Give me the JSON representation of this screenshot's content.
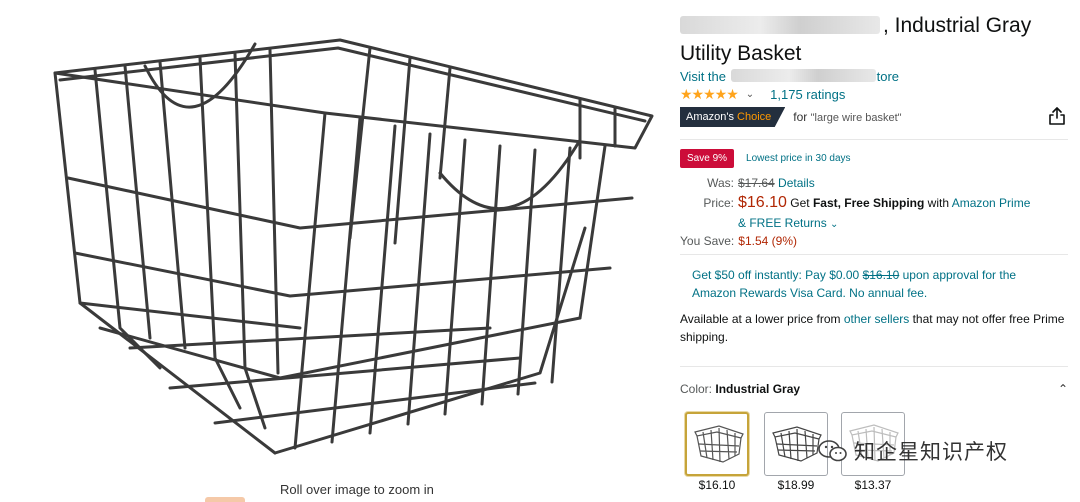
{
  "product": {
    "title_visible": ", Industrial Gray",
    "title_line2": "Utility Basket",
    "store_prefix": "Visit the",
    "store_suffix": "tore",
    "ratings_count": "1,175 ratings",
    "stars_glyphs": "★★★★★",
    "rating_value": 5
  },
  "badge": {
    "amazons": "Amazon's",
    "choice": "Choice",
    "for_text": "for",
    "query": "\"large wire basket\""
  },
  "deal": {
    "save_label": "Save 9%",
    "lowest_text": "Lowest price in 30 days"
  },
  "pricing": {
    "was_label": "Was:",
    "was_price": "$17.64",
    "details_link": "Details",
    "price_label": "Price:",
    "price": "$16.10",
    "get_text": "Get",
    "fast_free_shipping": "Fast, Free Shipping",
    "with_text": "with",
    "amazon_prime": "Amazon Prime",
    "free_returns": "& FREE Returns",
    "you_save_label": "You Save:",
    "you_save_value": "$1.54 (9%)"
  },
  "offer": {
    "part1": "Get $50 off instantly: Pay $0.00",
    "strike_price": "$16.10",
    "part2": "upon approval for the Amazon Rewards Visa Card. No annual fee."
  },
  "availability": {
    "part1": "Available at a lower price from",
    "link": "other sellers",
    "part2": "that may not offer free Prime shipping."
  },
  "color": {
    "label": "Color:",
    "selected": "Industrial Gray",
    "swatches": [
      {
        "price": "$16.10"
      },
      {
        "price": "$18.99"
      },
      {
        "price": "$13.37"
      }
    ]
  },
  "image": {
    "zoom_hint": "Roll over image to zoom in"
  },
  "watermark": {
    "text": "知企星知识产权"
  }
}
